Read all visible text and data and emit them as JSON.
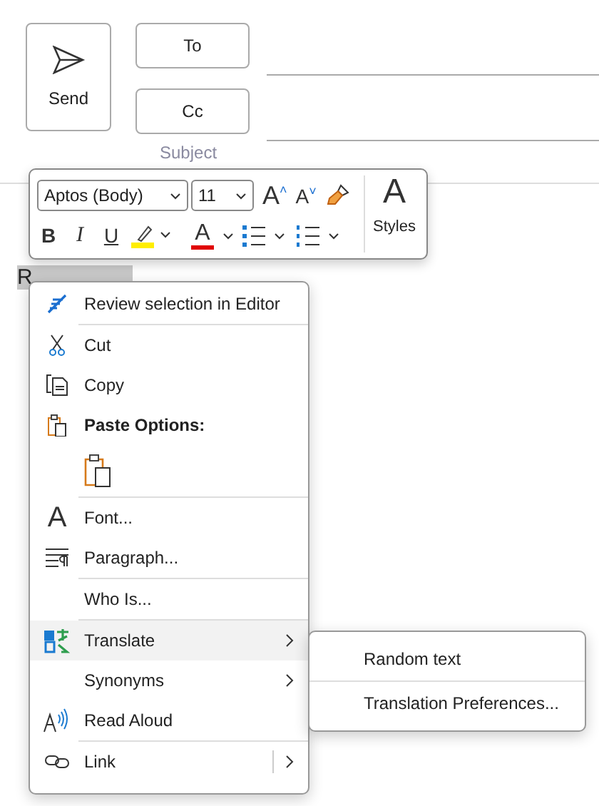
{
  "send_button": {
    "label": "Send"
  },
  "recipient_buttons": [
    "To",
    "Cc"
  ],
  "subject": {
    "placeholder": "Subject"
  },
  "body": {
    "text": "R",
    "selected": true
  },
  "toolbar": {
    "font": "Aptos (Body)",
    "size": "11",
    "grow": "A",
    "grow_caret": "˄",
    "shrink": "A",
    "shrink_caret": "˅",
    "bold": "B",
    "italic": "I",
    "underline": "U",
    "font_color": "A",
    "styles_glyph": "A",
    "styles_label": "Styles"
  },
  "context_menu": [
    {
      "kind": "item",
      "label": "Review selection in Editor",
      "selected": false,
      "submenu": false
    },
    {
      "kind": "separator"
    },
    {
      "kind": "item",
      "label": "Cut",
      "selected": false,
      "submenu": false
    },
    {
      "kind": "item",
      "label": "Copy",
      "selected": false,
      "submenu": false
    },
    {
      "kind": "header",
      "label": "Paste Options:"
    },
    {
      "kind": "paste"
    },
    {
      "kind": "separator"
    },
    {
      "kind": "item",
      "label": "Font...",
      "icon_glyph": "A",
      "selected": false,
      "submenu": false
    },
    {
      "kind": "item",
      "label": "Paragraph...",
      "selected": false,
      "submenu": false
    },
    {
      "kind": "separator"
    },
    {
      "kind": "item",
      "label": "Who Is...",
      "selected": false,
      "submenu": false
    },
    {
      "kind": "separator"
    },
    {
      "kind": "item",
      "label": "Translate",
      "selected": true,
      "submenu": true
    },
    {
      "kind": "item",
      "label": "Synonyms",
      "selected": false,
      "submenu": true
    },
    {
      "kind": "item",
      "label": "Read Aloud",
      "selected": false,
      "submenu": false
    },
    {
      "kind": "separator"
    },
    {
      "kind": "split",
      "label": "Link",
      "selected": false,
      "submenu": true
    }
  ],
  "submenu": [
    {
      "kind": "item",
      "label": "Random text"
    },
    {
      "kind": "separator"
    },
    {
      "kind": "item",
      "label": "Translation Preferences..."
    }
  ]
}
